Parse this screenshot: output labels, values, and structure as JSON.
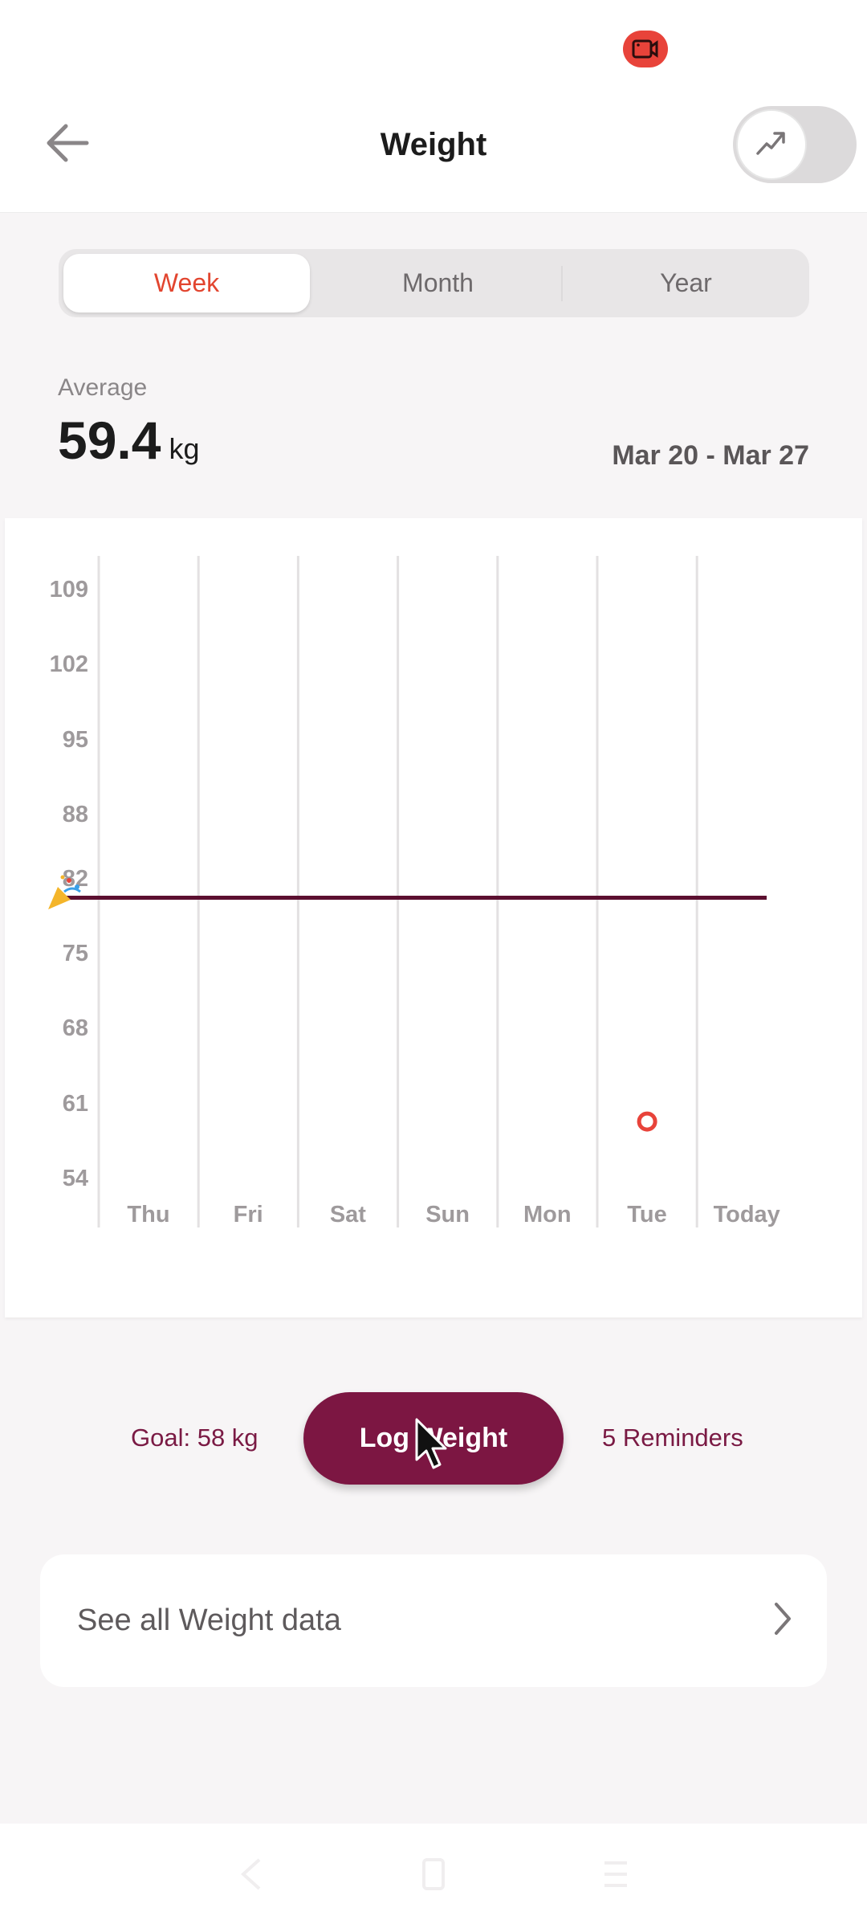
{
  "status_bar": {
    "icon": "screen-record-icon"
  },
  "header": {
    "back_icon": "arrow-left-icon",
    "title": "Weight",
    "toggle_icon": "trending-up-icon",
    "toggle_on": false
  },
  "period_tabs": [
    {
      "label": "Week",
      "active": true
    },
    {
      "label": "Month",
      "active": false
    },
    {
      "label": "Year",
      "active": false
    }
  ],
  "summary": {
    "average_label": "Average",
    "average_value": "59.4",
    "unit": "kg",
    "date_range": "Mar 20 - Mar 27"
  },
  "chart_data": {
    "type": "scatter",
    "title": "",
    "xlabel": "",
    "ylabel": "",
    "categories": [
      "Thu",
      "Fri",
      "Sat",
      "Sun",
      "Mon",
      "Tue",
      "Today"
    ],
    "y_ticks": [
      109,
      102,
      95,
      88,
      82,
      75,
      68,
      61,
      54
    ],
    "ylim": [
      54,
      109
    ],
    "grid": "vertical",
    "series": [
      {
        "name": "Weight",
        "values": [
          null,
          null,
          null,
          null,
          null,
          59.4,
          null
        ],
        "color": "#e8433a"
      }
    ],
    "reference_line": {
      "value": 80.3,
      "color": "#5c0f30",
      "marker": "party-popper-icon"
    }
  },
  "actions": {
    "goal_label": "Goal: 58 kg",
    "log_button": "Log Weight",
    "reminders_label": "5 Reminders"
  },
  "see_all": {
    "label": "See all Weight data",
    "icon": "chevron-right-icon"
  },
  "nav": {
    "back": "nav-back-icon",
    "home": "nav-home-icon",
    "recents": "nav-recents-icon"
  },
  "colors": {
    "accent": "#e2452f",
    "brand": "#7c1642",
    "goal_line": "#5c0f30"
  }
}
